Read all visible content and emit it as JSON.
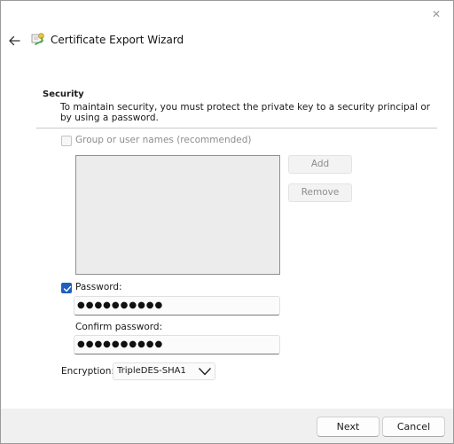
{
  "window": {
    "title": "Certificate Export Wizard",
    "close_glyph": "✕"
  },
  "security": {
    "title": "Security",
    "description": "To maintain security, you must protect the private key to a security principal or by using a password."
  },
  "group_option": {
    "label": "Group or user names (recommended)",
    "checked": false,
    "enabled": false
  },
  "group_buttons": {
    "add_label": "Add",
    "remove_label": "Remove"
  },
  "password": {
    "checkbox_label": "Password:",
    "checked": true,
    "value": "●●●●●●●●●●"
  },
  "confirm_password": {
    "label": "Confirm password:",
    "value": "●●●●●●●●●●"
  },
  "encryption": {
    "label": "Encryption:",
    "selected": "TripleDES-SHA1"
  },
  "footer": {
    "next_label": "Next",
    "cancel_label": "Cancel"
  },
  "colors": {
    "accent": "#1f5fbf",
    "panel": "#f0f0f0"
  },
  "icons": {
    "back": "back-arrow-icon",
    "wizard": "certificate-icon",
    "close": "close-icon",
    "checkmark": "checkmark-icon",
    "dropdown": "chevron-down-icon"
  }
}
